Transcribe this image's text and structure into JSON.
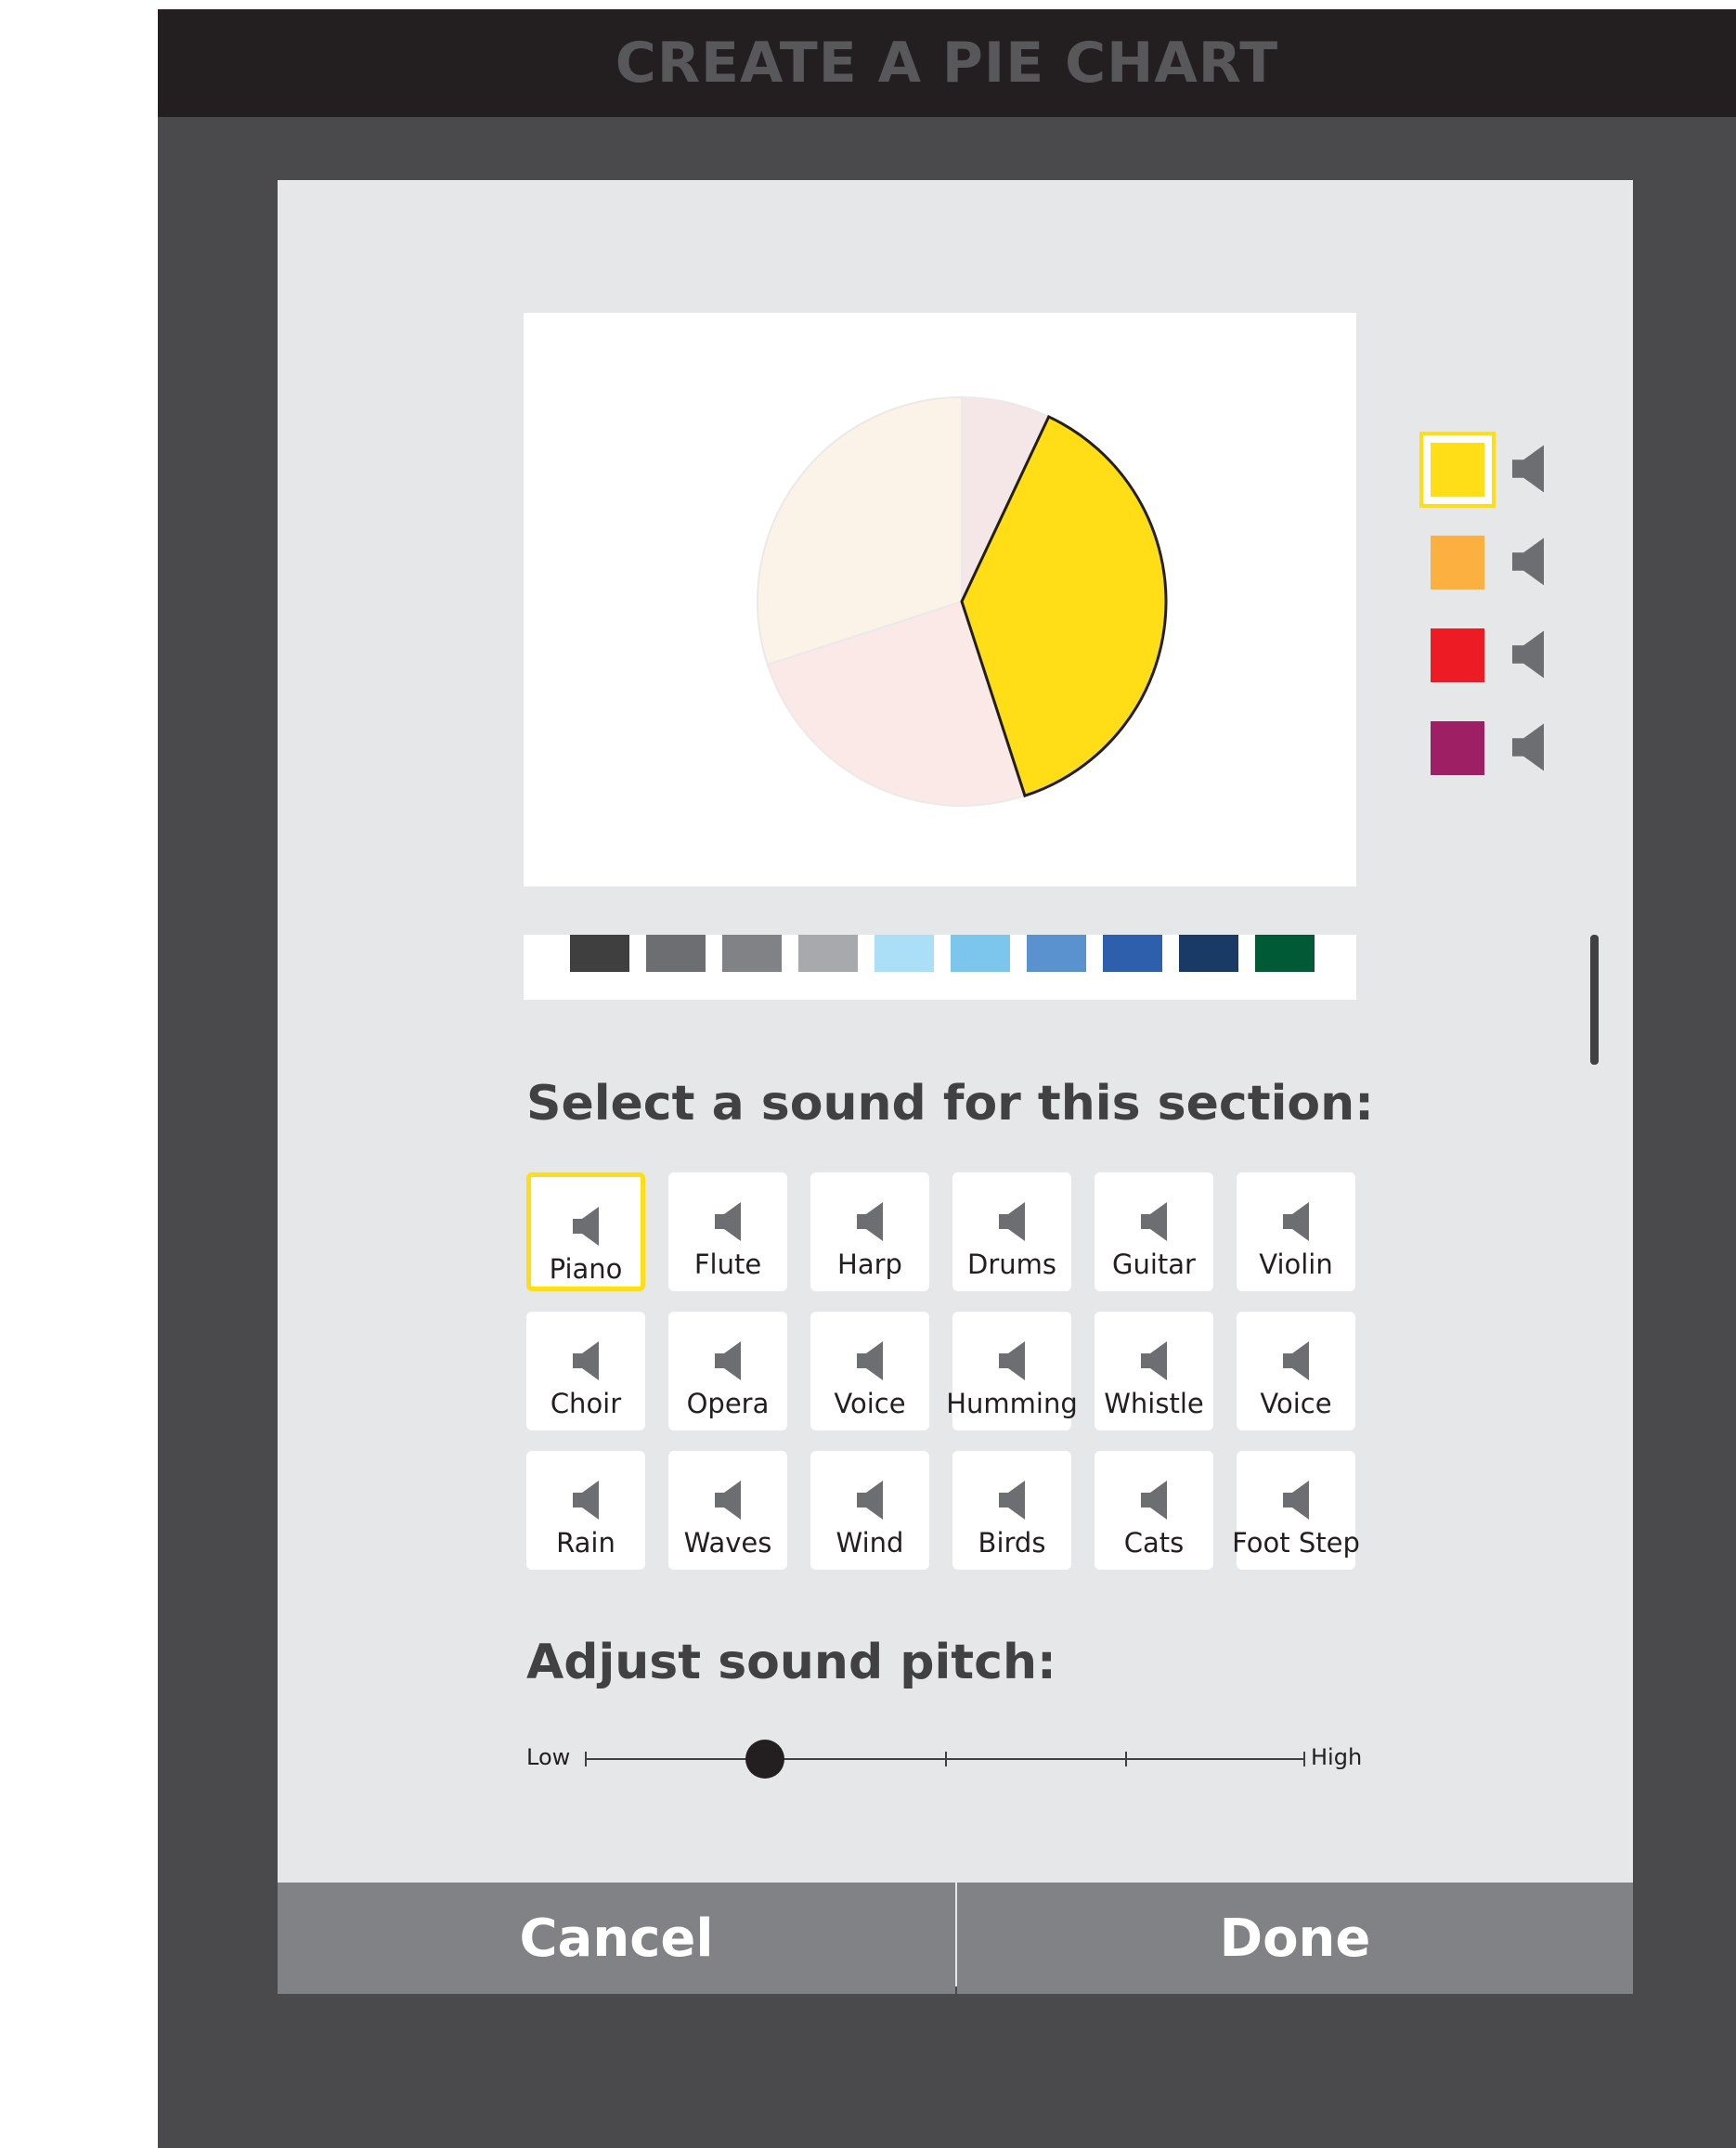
{
  "app": {
    "title": "CREATE A PIE CHART"
  },
  "chart_data": {
    "type": "pie",
    "slices": [
      {
        "value": 7,
        "color": "#f5e6e7",
        "selected": false
      },
      {
        "value": 38,
        "color": "#ffde17",
        "selected": true
      },
      {
        "value": 25,
        "color": "#fbe9e8",
        "selected": false
      },
      {
        "value": 30,
        "color": "#fbf2e8",
        "selected": false
      }
    ]
  },
  "palette": {
    "colors": [
      "#3f3f40",
      "#6d6e71",
      "#808285",
      "#a7a9ac",
      "#abdff7",
      "#7cc6ee",
      "#5a92d0",
      "#2e5fac",
      "#1a3a66",
      "#005a36"
    ]
  },
  "legend": {
    "items": [
      {
        "color": "#ffde17",
        "icon": "speaker-icon",
        "selected": true
      },
      {
        "color": "#fbb040",
        "icon": "speaker-icon",
        "selected": false
      },
      {
        "color": "#ed1c24",
        "icon": "speaker-icon",
        "selected": false
      },
      {
        "color": "#9e1f63",
        "icon": "speaker-icon",
        "selected": false
      }
    ]
  },
  "sound_section": {
    "heading": "Select a sound for this section:",
    "sounds": [
      {
        "label": "Piano",
        "selected": true
      },
      {
        "label": "Flute"
      },
      {
        "label": "Harp"
      },
      {
        "label": "Drums"
      },
      {
        "label": "Guitar"
      },
      {
        "label": "Violin"
      },
      {
        "label": "Choir"
      },
      {
        "label": "Opera"
      },
      {
        "label": "Voice"
      },
      {
        "label": "Humming"
      },
      {
        "label": "Whistle"
      },
      {
        "label": "Voice"
      },
      {
        "label": "Rain"
      },
      {
        "label": "Waves"
      },
      {
        "label": "Wind"
      },
      {
        "label": "Birds"
      },
      {
        "label": "Cats"
      },
      {
        "label": "Foot Step"
      }
    ]
  },
  "pitch": {
    "heading": "Adjust sound pitch:",
    "low_label": "Low",
    "high_label": "High",
    "value": 0.25
  },
  "footer": {
    "cancel_label": "Cancel",
    "done_label": "Done"
  }
}
